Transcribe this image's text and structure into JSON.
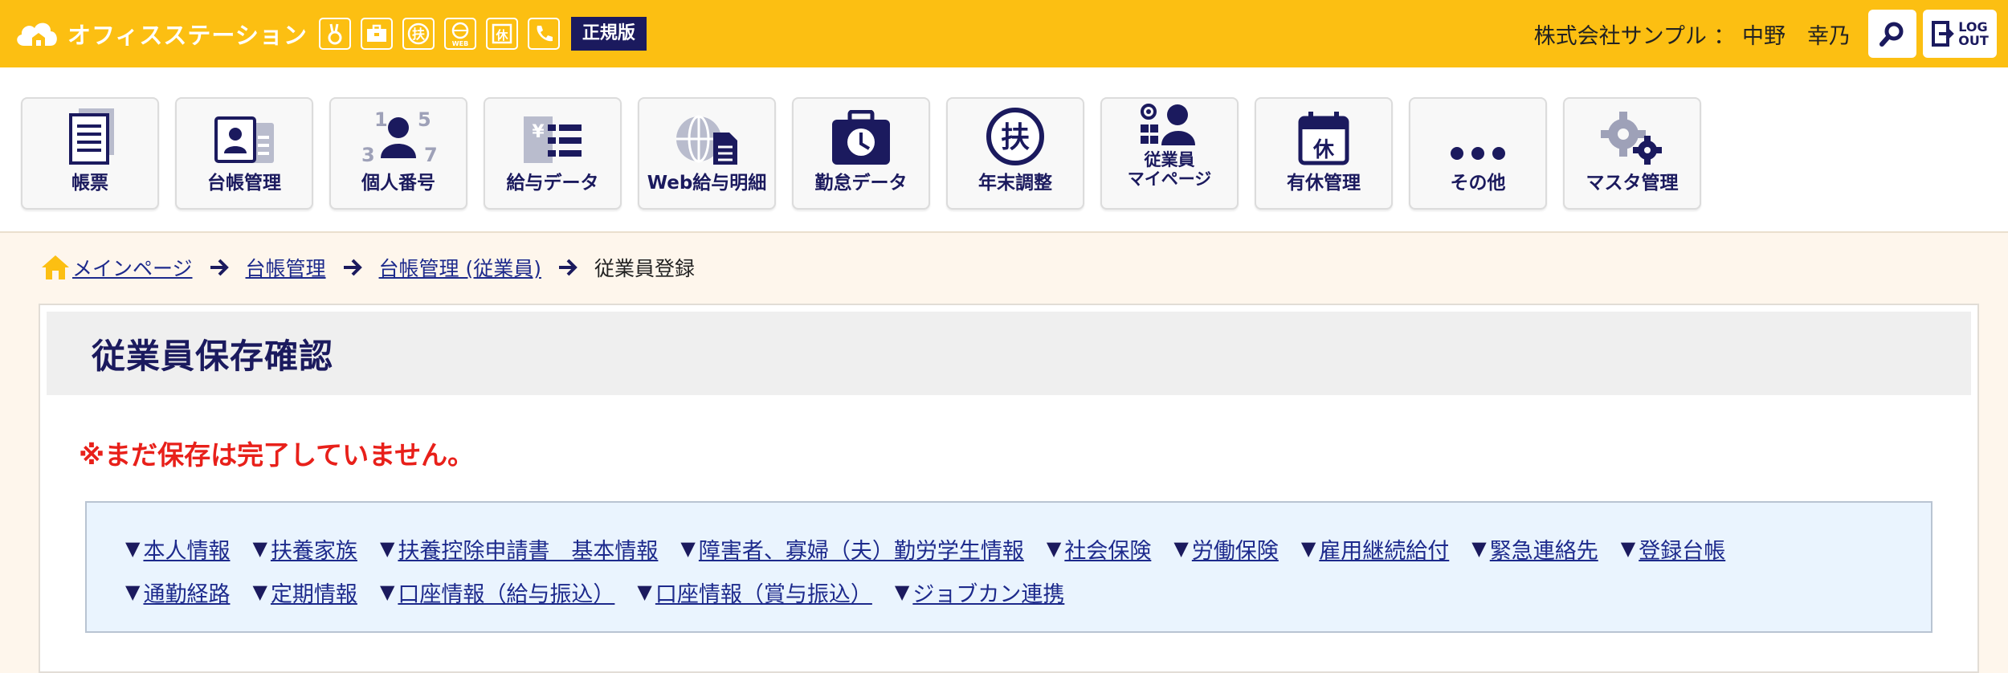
{
  "header": {
    "brand": "オフィスステーション",
    "mini_icons": [
      "rabbit-icon",
      "toolbox-icon",
      "fu-icon",
      "web-icon",
      "kyu-icon",
      "phone-icon"
    ],
    "edition": "正規版",
    "user": "株式会社サンプル ： 中野　幸乃",
    "logout_line1": "LOG",
    "logout_line2": "OUT"
  },
  "menu": {
    "items": [
      {
        "label": "帳票",
        "icon": "document-stack-icon"
      },
      {
        "label": "台帳管理",
        "icon": "ledger-card-icon"
      },
      {
        "label": "個人番号",
        "icon": "person-numbers-icon"
      },
      {
        "label": "給与データ",
        "icon": "yen-list-icon"
      },
      {
        "label": "Web給与明細",
        "icon": "globe-document-icon"
      },
      {
        "label": "勤怠データ",
        "icon": "timecard-clock-icon"
      },
      {
        "label": "年末調整",
        "icon": "fu-circle-icon"
      },
      {
        "label_line1": "従業員",
        "label_line2": "マイページ",
        "icon": "employee-page-icon"
      },
      {
        "label": "有休管理",
        "icon": "calendar-kyu-icon"
      },
      {
        "label": "その他",
        "icon": "ellipsis-icon"
      },
      {
        "label": "マスタ管理",
        "icon": "gears-icon"
      }
    ]
  },
  "breadcrumb": {
    "home": "メインページ",
    "level1": "台帳管理",
    "level2": "台帳管理 (従業員)",
    "current": "従業員登録"
  },
  "main": {
    "title": "従業員保存確認",
    "warning": "※まだ保存は完了していません。",
    "jump_links_row1": [
      "本人情報",
      "扶養家族",
      "扶養控除申請書　基本情報",
      "障害者、寡婦（夫）勤労学生情報",
      "社会保険",
      "労働保険",
      "雇用継続給付",
      "緊急連絡先",
      "登録台帳"
    ],
    "jump_links_row2": [
      "通勤経路",
      "定期情報",
      "口座情報（給与振込）",
      "口座情報（賞与振込）",
      "ジョブカン連携"
    ],
    "jump_marker": "▼"
  },
  "colors": {
    "header_bg": "#fcbf12",
    "navy": "#1b1a5e",
    "link": "#1d2a8c",
    "warning": "#e8201a",
    "page_bg": "#fef6ec",
    "jumpbox_bg": "#eaf4fe"
  }
}
